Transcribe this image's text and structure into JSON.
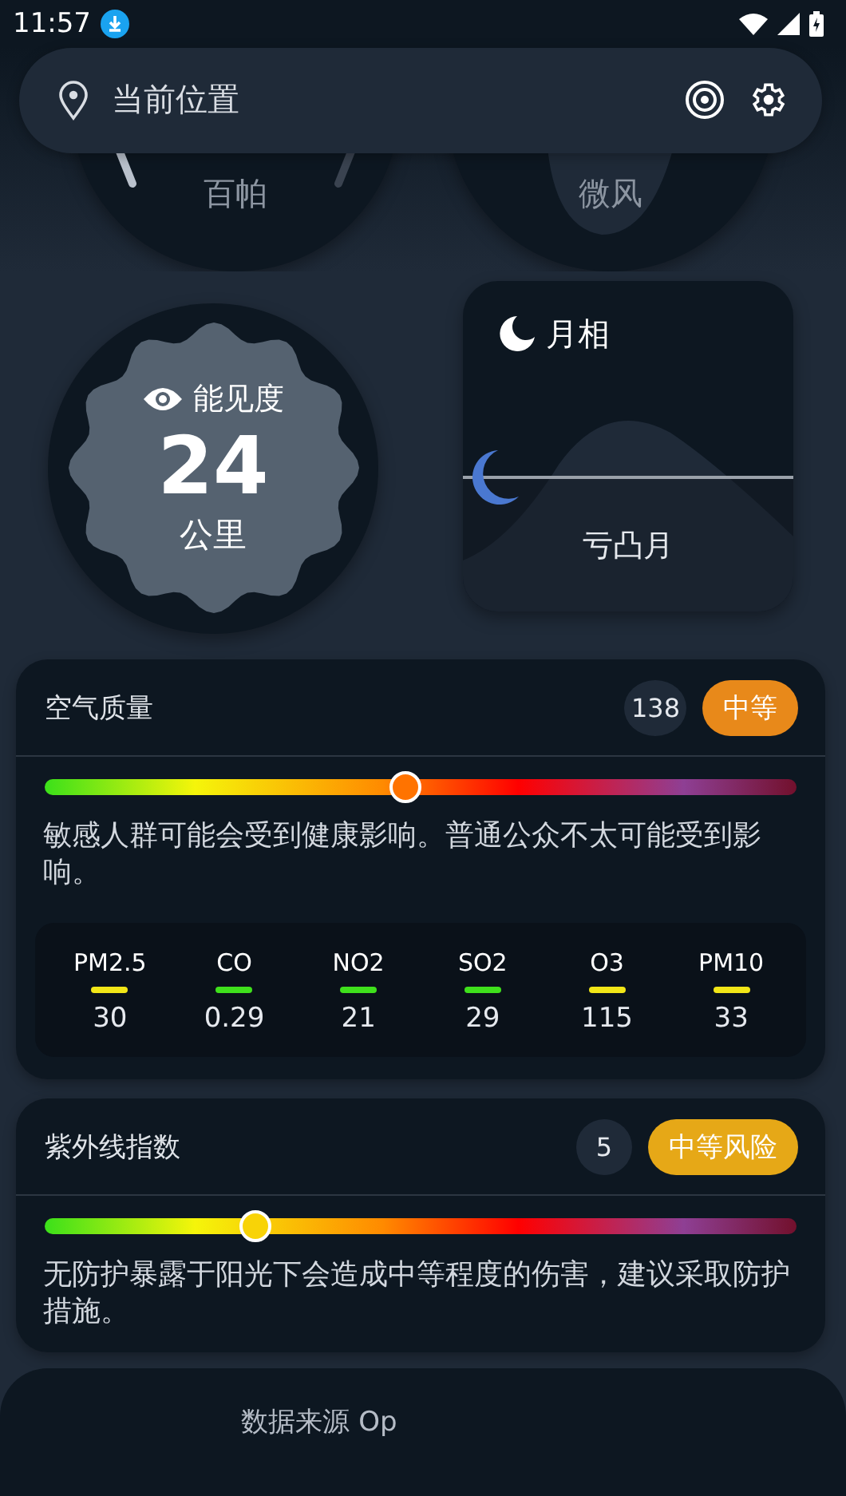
{
  "status_bar": {
    "time": "11:57"
  },
  "search_bar": {
    "location": "当前位置"
  },
  "top_gauges": [
    {
      "label": "百帕"
    },
    {
      "label": "微风"
    }
  ],
  "visibility": {
    "title": "能见度",
    "value": "24",
    "unit": "公里"
  },
  "moon": {
    "title": "月相",
    "phase": "亏凸月"
  },
  "indices": [
    {
      "title": "空气质量",
      "value": "138",
      "badge": {
        "text": "中等",
        "color": "#e8891a"
      },
      "level": 0.48,
      "description": "敏感人群可能会受到健康影响。普通公众不太可能受到影响。",
      "pollutants": [
        {
          "name": "PM2.5",
          "color": "#f2e617",
          "value": "30"
        },
        {
          "name": "CO",
          "color": "#3fe01c",
          "value": "0.29"
        },
        {
          "name": "NO2",
          "color": "#3fe01c",
          "value": "21"
        },
        {
          "name": "SO2",
          "color": "#3fe01c",
          "value": "29"
        },
        {
          "name": "O3",
          "color": "#f2e617",
          "value": "115"
        },
        {
          "name": "PM10",
          "color": "#f2e617",
          "value": "33"
        }
      ]
    },
    {
      "title": "紫外线指数",
      "value": "5",
      "badge": {
        "text": "中等风险",
        "color": "#e6a817"
      },
      "level": 0.28,
      "description": "无防护暴露于阳光下会造成中等程度的伤害，建议采取防护措施。"
    }
  ],
  "footer": {
    "text": "数据来源 Op"
  }
}
